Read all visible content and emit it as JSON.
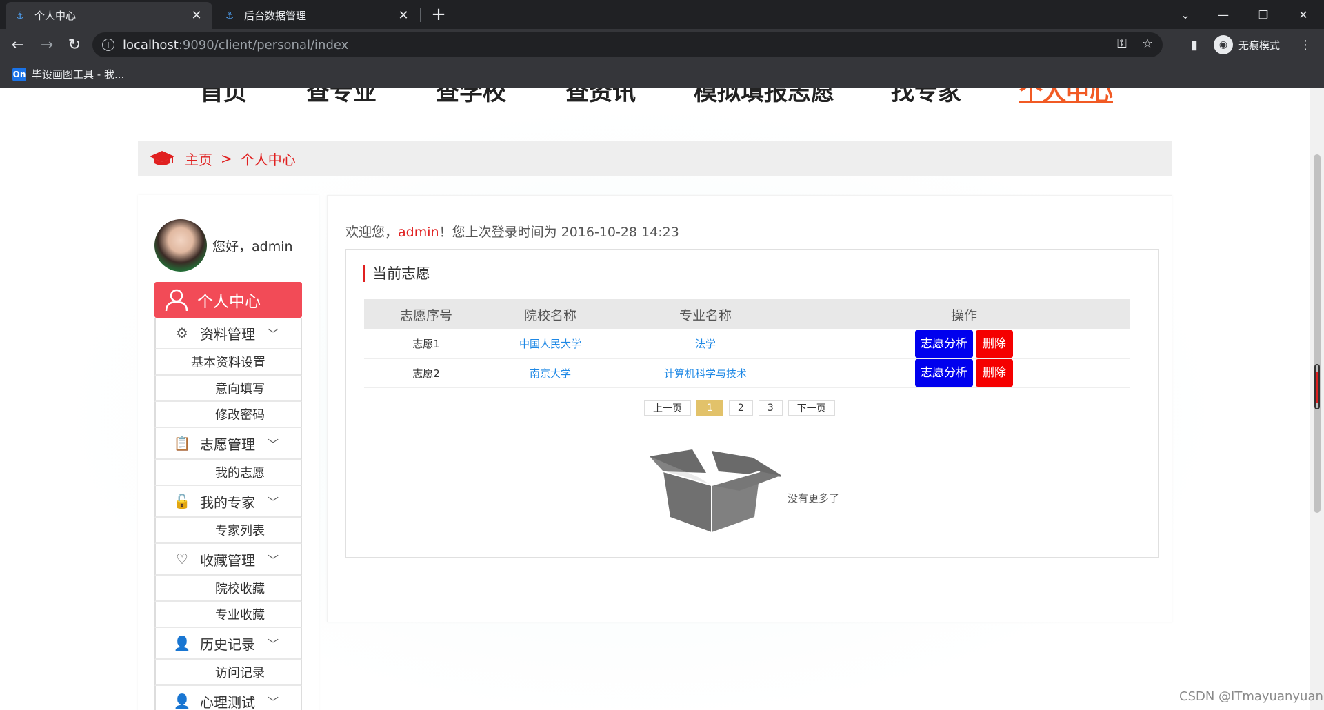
{
  "browser": {
    "tabs": [
      {
        "title": "个人中心",
        "active": true
      },
      {
        "title": "后台数据管理",
        "active": false
      }
    ],
    "url_host": "localhost",
    "url_rest": ":9090/client/personal/index",
    "incognito_label": "无痕模式",
    "bookmark": {
      "icon_text": "On",
      "label": "毕设画图工具 - 我..."
    }
  },
  "site_nav": [
    "首页",
    "查专业",
    "查学校",
    "查资讯",
    "模拟填报志愿",
    "找专家",
    "个人中心"
  ],
  "breadcrumb": {
    "home": "主页",
    "sep": ">",
    "current": "个人中心"
  },
  "sidebar": {
    "greeting": "您好，admin",
    "main_item": "个人中心",
    "groups": [
      {
        "label": "资料管理",
        "icon": "gear-icon",
        "items": [
          "基本资料设置",
          "意向填写",
          "修改密码"
        ]
      },
      {
        "label": "志愿管理",
        "icon": "clipboard-icon",
        "items": [
          "我的志愿"
        ]
      },
      {
        "label": "我的专家",
        "icon": "lock-icon",
        "items": [
          "专家列表"
        ]
      },
      {
        "label": "收藏管理",
        "icon": "heart-icon",
        "items": [
          "院校收藏",
          "专业收藏"
        ]
      },
      {
        "label": "历史记录",
        "icon": "user-icon",
        "items": [
          "访问记录"
        ]
      },
      {
        "label": "心理测试",
        "icon": "user-icon",
        "items": []
      }
    ]
  },
  "content": {
    "welcome_prefix": "欢迎您，",
    "username": "admin",
    "welcome_suffix": "！您上次登录时间为 2016-10-28 14:23",
    "card_title": "当前志愿",
    "table": {
      "headers": [
        "志愿序号",
        "院校名称",
        "专业名称",
        "操作"
      ],
      "rows": [
        {
          "no": "志愿1",
          "school": "中国人民大学",
          "major": "法学"
        },
        {
          "no": "志愿2",
          "school": "南京大学",
          "major": "计算机科学与技术"
        }
      ],
      "analyze_label": "志愿分析",
      "delete_label": "删除"
    },
    "pager": {
      "prev": "上一页",
      "pages": [
        "1",
        "2",
        "3"
      ],
      "current": "1",
      "next": "下一页"
    },
    "empty_text": "没有更多了"
  },
  "watermark": "CSDN @ITmayuanyuan",
  "colors": {
    "accent_red": "#e02020",
    "menu_active": "#f24b57",
    "nav_active": "#f15a24",
    "analyze_btn": "#0000ee",
    "delete_btn": "#f50000",
    "pager_current": "#e2c26a"
  }
}
